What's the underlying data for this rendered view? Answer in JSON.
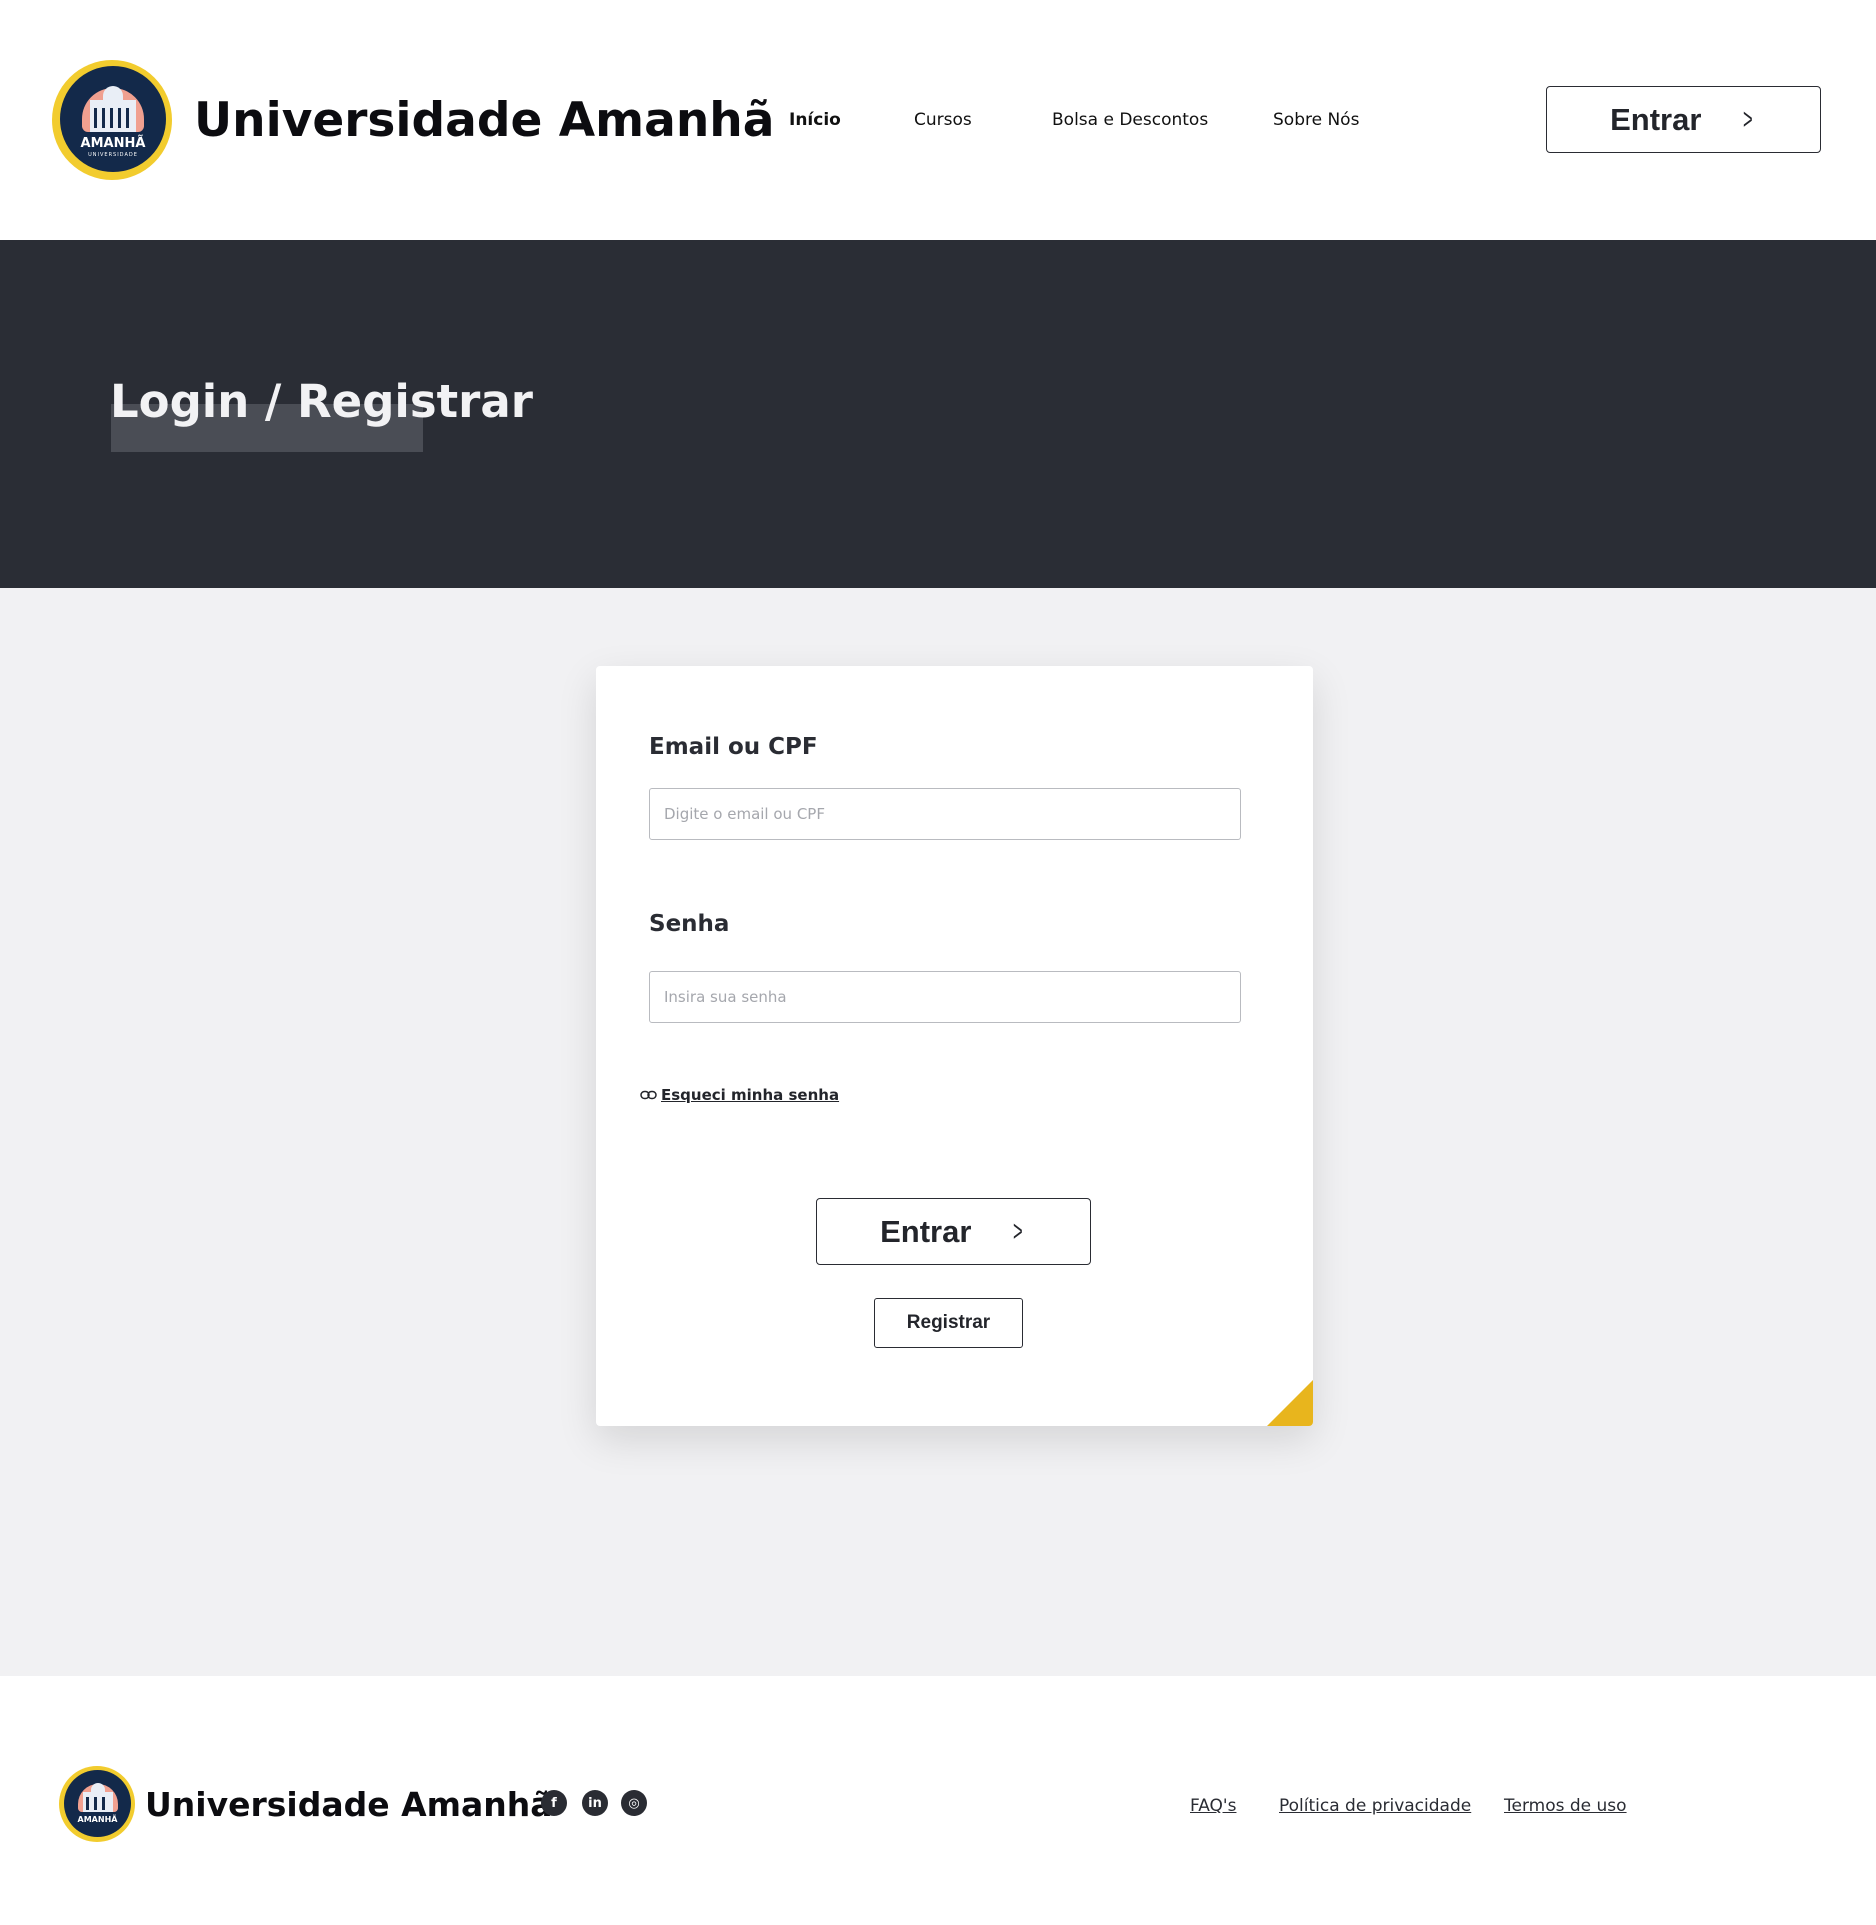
{
  "header": {
    "brand_name": "Universidade Amanhã",
    "logo_text": "AMANHÃ",
    "logo_subtext": "UNIVERSIDADE",
    "nav": [
      {
        "label": "Início",
        "active": true
      },
      {
        "label": "Cursos",
        "active": false
      },
      {
        "label": "Bolsa e Descontos",
        "active": false
      },
      {
        "label": "Sobre Nós",
        "active": false
      }
    ],
    "enter_label": "Entrar"
  },
  "hero": {
    "title": "Login / Registrar"
  },
  "form": {
    "email_label": "Email ou CPF",
    "email_placeholder": "Digite o email ou CPF",
    "email_value": "",
    "password_label": "Senha",
    "password_placeholder": "Insira sua senha",
    "password_value": "",
    "forgot_label": "Esqueci minha senha",
    "enter_label": "Entrar",
    "register_label": "Registrar"
  },
  "footer": {
    "brand_name": "Universidade Amanhã",
    "logo_text": "AMANHÃ",
    "social": [
      {
        "name": "facebook-icon",
        "glyph": "f"
      },
      {
        "name": "linkedin-icon",
        "glyph": "in"
      },
      {
        "name": "instagram-icon",
        "glyph": "◎"
      }
    ],
    "links": [
      "FAQ's",
      "Política de privacidade",
      "Termos de uso"
    ]
  },
  "colors": {
    "accent": "#e8b51d",
    "hero_bg": "#2a2d35",
    "page_bg": "#f1f1f3",
    "text": "#23252b"
  }
}
